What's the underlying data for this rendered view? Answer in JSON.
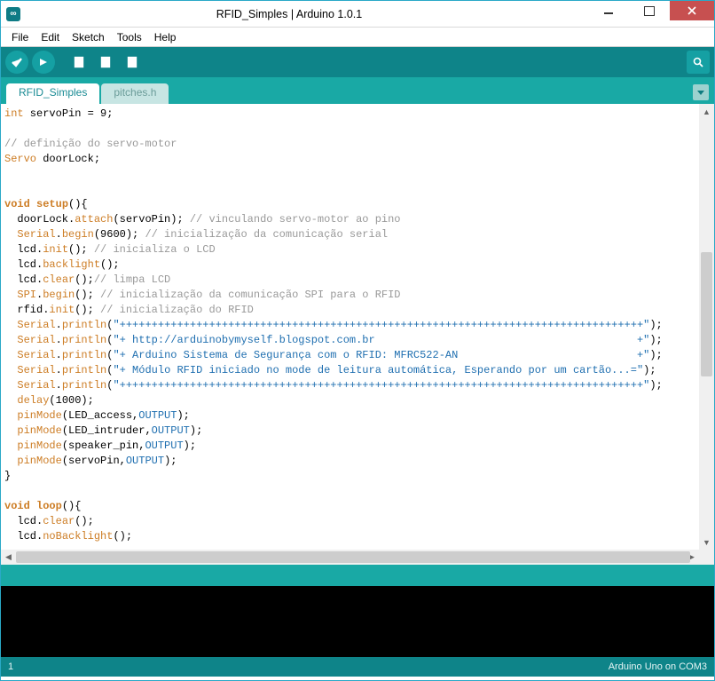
{
  "titlebar": {
    "title": "RFID_Simples | Arduino 1.0.1"
  },
  "menubar": {
    "items": [
      "File",
      "Edit",
      "Sketch",
      "Tools",
      "Help"
    ]
  },
  "tabs": {
    "items": [
      {
        "label": "RFID_Simples",
        "active": true
      },
      {
        "label": "pitches.h",
        "active": false
      }
    ]
  },
  "statusbar": {
    "line": "1",
    "board": "Arduino Uno on COM3"
  },
  "code": {
    "lines": [
      [
        [
          "kw",
          "int"
        ],
        [
          "txt",
          " servoPin = 9;"
        ]
      ],
      [],
      [
        [
          "cmt",
          "// definição do servo-motor"
        ]
      ],
      [
        [
          "kw",
          "Servo"
        ],
        [
          "txt",
          " doorLock;"
        ]
      ],
      [],
      [],
      [
        [
          "kw2",
          "void"
        ],
        [
          "txt",
          " "
        ],
        [
          "kw2",
          "setup"
        ],
        [
          "txt",
          "(){"
        ]
      ],
      [
        [
          "txt",
          "  doorLock."
        ],
        [
          "mbr",
          "attach"
        ],
        [
          "txt",
          "(servoPin); "
        ],
        [
          "cmt",
          "// vinculando servo-motor ao pino"
        ]
      ],
      [
        [
          "txt",
          "  "
        ],
        [
          "kw",
          "Serial"
        ],
        [
          "txt",
          "."
        ],
        [
          "mbr",
          "begin"
        ],
        [
          "txt",
          "(9600); "
        ],
        [
          "cmt",
          "// inicialização da comunicação serial"
        ]
      ],
      [
        [
          "txt",
          "  lcd."
        ],
        [
          "mbr",
          "init"
        ],
        [
          "txt",
          "(); "
        ],
        [
          "cmt",
          "// inicializa o LCD"
        ]
      ],
      [
        [
          "txt",
          "  lcd."
        ],
        [
          "mbr",
          "backlight"
        ],
        [
          "txt",
          "();"
        ]
      ],
      [
        [
          "txt",
          "  lcd."
        ],
        [
          "mbr",
          "clear"
        ],
        [
          "txt",
          "();"
        ],
        [
          "cmt",
          "// limpa LCD"
        ]
      ],
      [
        [
          "txt",
          "  "
        ],
        [
          "kw",
          "SPI"
        ],
        [
          "txt",
          "."
        ],
        [
          "mbr",
          "begin"
        ],
        [
          "txt",
          "(); "
        ],
        [
          "cmt",
          "// inicialização da comunicação SPI para o RFID"
        ]
      ],
      [
        [
          "txt",
          "  rfid."
        ],
        [
          "mbr",
          "init"
        ],
        [
          "txt",
          "(); "
        ],
        [
          "cmt",
          "// inicialização do RFID"
        ]
      ],
      [
        [
          "txt",
          "  "
        ],
        [
          "kw",
          "Serial"
        ],
        [
          "txt",
          "."
        ],
        [
          "mbr",
          "println"
        ],
        [
          "txt",
          "("
        ],
        [
          "str",
          "\"++++++++++++++++++++++++++++++++++++++++++++++++++++++++++++++++++++++++++++++++++\""
        ],
        [
          "txt",
          ");"
        ]
      ],
      [
        [
          "txt",
          "  "
        ],
        [
          "kw",
          "Serial"
        ],
        [
          "txt",
          "."
        ],
        [
          "mbr",
          "println"
        ],
        [
          "txt",
          "("
        ],
        [
          "str",
          "\"+ http://arduinobymyself.blogspot.com.br                                         +\""
        ],
        [
          "txt",
          ");"
        ]
      ],
      [
        [
          "txt",
          "  "
        ],
        [
          "kw",
          "Serial"
        ],
        [
          "txt",
          "."
        ],
        [
          "mbr",
          "println"
        ],
        [
          "txt",
          "("
        ],
        [
          "str",
          "\"+ Arduino Sistema de Segurança com o RFID: MFRC522-AN                            +\""
        ],
        [
          "txt",
          ");"
        ]
      ],
      [
        [
          "txt",
          "  "
        ],
        [
          "kw",
          "Serial"
        ],
        [
          "txt",
          "."
        ],
        [
          "mbr",
          "println"
        ],
        [
          "txt",
          "("
        ],
        [
          "str",
          "\"+ Módulo RFID iniciado no mode de leitura automática, Esperando por um cartão...=\""
        ],
        [
          "txt",
          ");"
        ]
      ],
      [
        [
          "txt",
          "  "
        ],
        [
          "kw",
          "Serial"
        ],
        [
          "txt",
          "."
        ],
        [
          "mbr",
          "println"
        ],
        [
          "txt",
          "("
        ],
        [
          "str",
          "\"++++++++++++++++++++++++++++++++++++++++++++++++++++++++++++++++++++++++++++++++++\""
        ],
        [
          "txt",
          ");"
        ]
      ],
      [
        [
          "txt",
          "  "
        ],
        [
          "mbr",
          "delay"
        ],
        [
          "txt",
          "(1000);"
        ]
      ],
      [
        [
          "txt",
          "  "
        ],
        [
          "mbr",
          "pinMode"
        ],
        [
          "txt",
          "(LED_access,"
        ],
        [
          "const",
          "OUTPUT"
        ],
        [
          "txt",
          ");"
        ]
      ],
      [
        [
          "txt",
          "  "
        ],
        [
          "mbr",
          "pinMode"
        ],
        [
          "txt",
          "(LED_intruder,"
        ],
        [
          "const",
          "OUTPUT"
        ],
        [
          "txt",
          ");"
        ]
      ],
      [
        [
          "txt",
          "  "
        ],
        [
          "mbr",
          "pinMode"
        ],
        [
          "txt",
          "(speaker_pin,"
        ],
        [
          "const",
          "OUTPUT"
        ],
        [
          "txt",
          ");"
        ]
      ],
      [
        [
          "txt",
          "  "
        ],
        [
          "mbr",
          "pinMode"
        ],
        [
          "txt",
          "(servoPin,"
        ],
        [
          "const",
          "OUTPUT"
        ],
        [
          "txt",
          ");"
        ]
      ],
      [
        [
          "txt",
          "}"
        ]
      ],
      [],
      [
        [
          "kw2",
          "void"
        ],
        [
          "txt",
          " "
        ],
        [
          "kw2",
          "loop"
        ],
        [
          "txt",
          "(){"
        ]
      ],
      [
        [
          "txt",
          "  lcd."
        ],
        [
          "mbr",
          "clear"
        ],
        [
          "txt",
          "();"
        ]
      ],
      [
        [
          "txt",
          "  lcd."
        ],
        [
          "mbr",
          "noBacklight"
        ],
        [
          "txt",
          "();"
        ]
      ]
    ]
  }
}
